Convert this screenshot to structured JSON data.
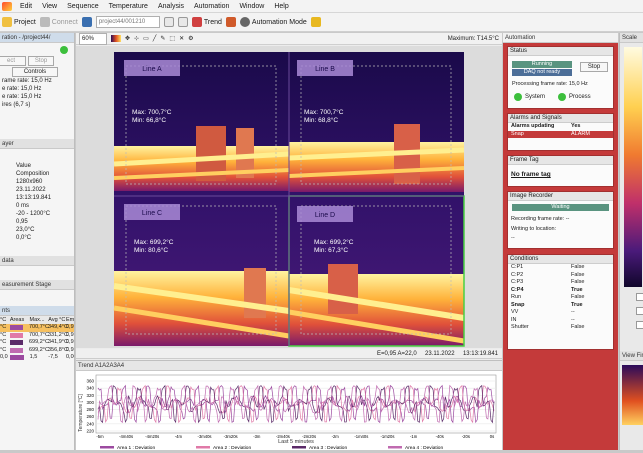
{
  "menu": {
    "items": [
      "Edit",
      "View",
      "Sequence",
      "Temperature",
      "Analysis",
      "Automation",
      "Window",
      "Help"
    ]
  },
  "toolbar": {
    "project": "Project",
    "connect": "Connect",
    "project_combo": "project44/001210",
    "trend": "Trend",
    "automation_mode": "Automation Mode"
  },
  "left": {
    "project_header": "ration - /project44/",
    "btn_connect": "ect",
    "btn_stop": "Stop",
    "btn_controls": "Controls",
    "lines": [
      "rame rate: 15,0 Hz",
      "e rate: 15,0 Hz",
      "e rate: 15,0 Hz",
      "ires (6,7 s)"
    ],
    "layer_header": "ayer",
    "props_value": "Value",
    "props": [
      "Composition",
      "1280x960",
      "23.11.2022",
      "13:13:19.841",
      "0 ms",
      "-20 - 1200°C",
      "0,95",
      "23,0°C",
      "0,0°C"
    ],
    "data_header": "data",
    "measure_header": "easurement Stage",
    "areas_header": "nts",
    "areas_cols": [
      "°C",
      "Areas",
      "Max...",
      "Avg °C",
      "Emi"
    ],
    "areas_rows": [
      [
        "°C",
        "700,7°C",
        "349,4°C",
        "0,95"
      ],
      [
        "°C",
        "700,7°C",
        "331,2°C",
        "0,95"
      ],
      [
        "°C",
        "699,2°C",
        "341,9°C",
        "0,95"
      ],
      [
        "°C",
        "699,2°C",
        "356,8°C",
        "0,95"
      ],
      [
        "0,0",
        "1,5",
        "-7,5",
        "0,00"
      ]
    ]
  },
  "image": {
    "zoom": "60%",
    "maximum": "Maximum: T14.5°C",
    "footer": "E=0,95  A=22,0",
    "footer_date": "23.11.2022",
    "footer_time": "13:13:19.841",
    "quads": [
      {
        "label": "Line A",
        "max": "Max: 700,7°C",
        "min": "Min: 66,8°C"
      },
      {
        "label": "Line B",
        "max": "Max: 700,7°C",
        "min": "Min: 68,8°C"
      },
      {
        "label": "Line C",
        "max": "Max: 699,2°C",
        "min": "Min: 80,6°C"
      },
      {
        "label": "Line D",
        "max": "Max: 699,2°C",
        "min": "Min: 67,3°C"
      }
    ]
  },
  "trend": {
    "title": "Trend A1A2A3A4",
    "ylabel": "Temperature [°C]",
    "xlabel": "Last 5 minutes",
    "xticks": [
      "-5m",
      "-4m40s",
      "-4m20s",
      "-4m",
      "-3m40s",
      "-3m20s",
      "-3m",
      "-2m40s",
      "-2m20s",
      "-2m",
      "-1m40s",
      "-1m20s",
      "-1m",
      "-40s",
      "-20s",
      "0s"
    ],
    "yticks": [
      "360",
      "340",
      "320",
      "300",
      "280",
      "260",
      "240",
      "220"
    ],
    "legend": [
      "Area 1 : Deviation",
      "Area 2 : Deviation",
      "Area 3 : Deviation",
      "Area 4 : Deviation"
    ],
    "colors": [
      "#9c4aa0",
      "#e07aa8",
      "#5b2a68",
      "#c06bb0"
    ]
  },
  "automation": {
    "header": "Automation",
    "status_header": "Status",
    "running": "Running",
    "daq": "DAQ not ready",
    "stop": "Stop",
    "pfr": "Processing frame rate: 15,0 Hz",
    "system": "System",
    "process": "Process",
    "alarms_header": "Alarms and Signals",
    "alarms_updating": "Alarms updating",
    "yes": "Yes",
    "snap": "Snap",
    "alarm": "ALARM",
    "frametag_header": "Frame Tag",
    "no_frame_tag": "No frame tag",
    "recorder_header": "Image Recorder",
    "waiting": "Waiting",
    "recording_rate": "Recording frame rate: --",
    "writing": "Writing to location:",
    "dashes": "--",
    "cond_header": "Conditions",
    "conditions": [
      [
        "C:P1",
        "False"
      ],
      [
        "C:P2",
        "False"
      ],
      [
        "C:P3",
        "False"
      ],
      [
        "C:P4",
        "True"
      ],
      [
        "Run",
        "False"
      ],
      [
        "Snap",
        "True"
      ],
      [
        "VV",
        "--"
      ],
      [
        "IN",
        "--"
      ],
      [
        "Shutter",
        "False"
      ]
    ]
  },
  "scale": {
    "header": "Scale",
    "view_header": "View Fin"
  }
}
